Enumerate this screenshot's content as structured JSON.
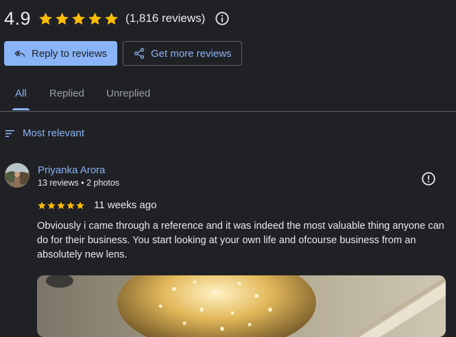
{
  "summary": {
    "rating": "4.9",
    "stars": 5,
    "review_count": "(1,816 reviews)",
    "star_color": "#fbbc04",
    "info_icon": "info-icon"
  },
  "actions": {
    "reply_label": "Reply to reviews",
    "reply_icon": "reply-all-icon",
    "get_more_label": "Get more reviews",
    "get_more_icon": "share-icon"
  },
  "tabs": [
    {
      "label": "All",
      "active": true
    },
    {
      "label": "Replied",
      "active": false
    },
    {
      "label": "Unreplied",
      "active": false
    }
  ],
  "sort": {
    "label": "Most relevant",
    "icon": "sort-icon"
  },
  "review": {
    "name": "Priyanka Arora",
    "meta": "13 reviews • 2 photos",
    "stars": 5,
    "date": "11 weeks ago",
    "text": "Obviously i came through a reference and it was indeed the most valuable thing anyone can do for their business. You start looking at your own life and ofcourse business from an absolutely new lens.",
    "report_icon": "report-icon"
  },
  "colors": {
    "background": "#202124",
    "accent": "#8ab4f8",
    "text": "#e8eaed",
    "muted": "#9aa0a6",
    "divider": "#5f6368"
  }
}
